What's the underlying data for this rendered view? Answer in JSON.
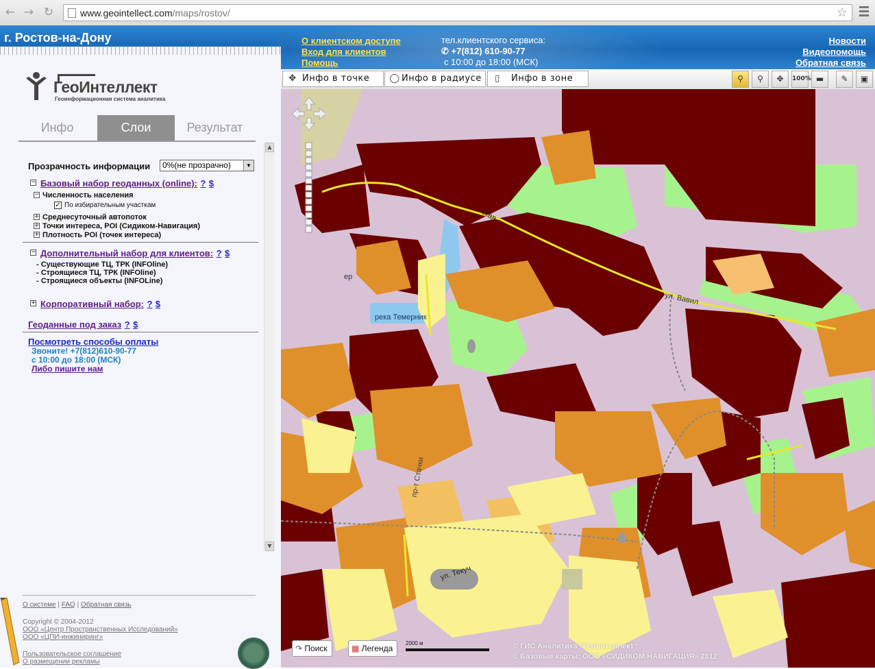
{
  "browser": {
    "url_host": "www.geointellect.com",
    "url_path": "/maps/rostov/"
  },
  "header": {
    "city": "г. Ростов-на-Дону",
    "client_access_link": "О клиентском доступе",
    "client_login_link": "Вход для клиентов",
    "help_link": "Помощь",
    "service_label": "тел.клиентского сервиса:",
    "service_phone": "+7(812) 610-90-77",
    "service_hours": "с 10:00 до 18:00 (МСК)",
    "news_link": "Новости",
    "video_help_link": "Видеопомощь",
    "feedback_link": "Обратная связь"
  },
  "logo": {
    "name": "ГеоИнтеллект",
    "tagline": "Геоинформационная система аналитика"
  },
  "tabs": [
    {
      "label": "Инфо",
      "active": false
    },
    {
      "label": "Слои",
      "active": true
    },
    {
      "label": "Результат",
      "active": false
    }
  ],
  "layers": {
    "opacity_label": "Прозрачность информации",
    "opacity_value": "0%(не прозрачно)",
    "base_set": {
      "label": "Базовый набор геоданных (online):",
      "help": "?",
      "price": "$"
    },
    "population": "Численность населения",
    "by_districts": "По избирательным участкам",
    "traffic": "Среднесуточный автопоток",
    "poi": "Точки интереса, POI (Сидиком-Навигация)",
    "poi_density": "Плотность POI (точек интереса)",
    "extra_set": {
      "label": "Дополнительный набор для клиентов:",
      "help": "?",
      "price": "$"
    },
    "extra_items": [
      "- Существующие ТЦ, ТРК (INFOline)",
      "- Строящиеся ТЦ, ТРК (INFOline)",
      "- Строящиеся объекты (INFOLine)"
    ],
    "corp_set": {
      "label": "Корпоративный набор:",
      "help": "?",
      "price": "$"
    },
    "custom": {
      "label": "Геоданные под заказ",
      "help": "?",
      "price": "$"
    },
    "payment_link": "Посмотреть способы оплаты",
    "call_line": "Звоните! +7(812)610-90-77",
    "hours_line": "с 10:00 до 18:00 (МСК)",
    "write_link": "Либо пишите нам"
  },
  "footer": {
    "links": [
      "О системе",
      "FAQ",
      "Обратная связь"
    ],
    "separator": "|",
    "copyright": "Copyright © 2004-2012",
    "org1": "ООО «Центр Пространственных Исследований»",
    "org2": "ООО «ЦПИ-инжиниринг»",
    "agreement": "Пользовательское соглашение",
    "ads": "О размещении рекламы"
  },
  "toolbar": {
    "info_point": "Инфо в точке",
    "info_radius": "Инфо в радиусе",
    "info_zone": "Инфо в зоне",
    "zoom_100": "100%",
    "icons": [
      "zoom-in-icon",
      "zoom-out-icon",
      "pan-icon",
      "ruler-icon",
      "pencil-icon",
      "resize-icon"
    ]
  },
  "map": {
    "river_label": "река Темерник",
    "street_labels": [
      "ская",
      "ул. Вавил",
      "пр-т Стачки",
      "ул. Текуч"
    ],
    "left_edge_label": "ер",
    "scale_label": "2000 м",
    "search_button": "Поиск",
    "legend_button": "Легенда",
    "copyright_1": "© ГИС Аналитика \"Геоинтеллект\"",
    "copyright_2": "© Базовые карты: ООО «СИДИКОМ НАВИГАЦИЯ» 2012",
    "colors": {
      "very_high": "#6b0000",
      "high": "#e0902a",
      "medium": "#f2c060",
      "low": "#faf290",
      "green": "#a6f38d",
      "residential": "#d9c2d6",
      "water": "#8ec8ee",
      "road": "#e8e82a"
    }
  }
}
